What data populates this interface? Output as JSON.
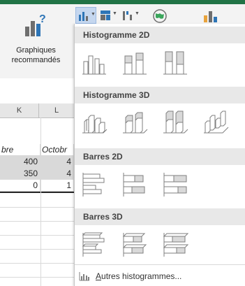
{
  "ribbon": {
    "recommended_charts_label_line1": "Graphiques",
    "recommended_charts_label_line2": "recommandés",
    "accent": "#217346"
  },
  "sheet": {
    "col_headers": [
      "L"
    ],
    "partial_col_header_left": "K",
    "row_header_cells": [
      "bre",
      "Octobr"
    ],
    "rows": [
      [
        "400",
        "4"
      ],
      [
        "350",
        "4"
      ],
      [
        "0",
        "1"
      ]
    ]
  },
  "menu": {
    "sections": [
      {
        "title": "Histogramme 2D",
        "icons": [
          "clustered-column-icon",
          "stacked-column-icon",
          "100-stacked-column-icon"
        ]
      },
      {
        "title": "Histogramme 3D",
        "icons": [
          "3d-clustered-column-icon",
          "3d-stacked-column-icon",
          "3d-100-stacked-column-icon",
          "3d-column-icon"
        ]
      },
      {
        "title": "Barres 2D",
        "icons": [
          "clustered-bar-icon",
          "stacked-bar-icon",
          "100-stacked-bar-icon"
        ]
      },
      {
        "title": "Barres 3D",
        "icons": [
          "3d-clustered-bar-icon",
          "3d-stacked-bar-icon",
          "3d-100-stacked-bar-icon"
        ]
      }
    ],
    "more_label_first": "A",
    "more_label_rest": "utres histogrammes..."
  }
}
